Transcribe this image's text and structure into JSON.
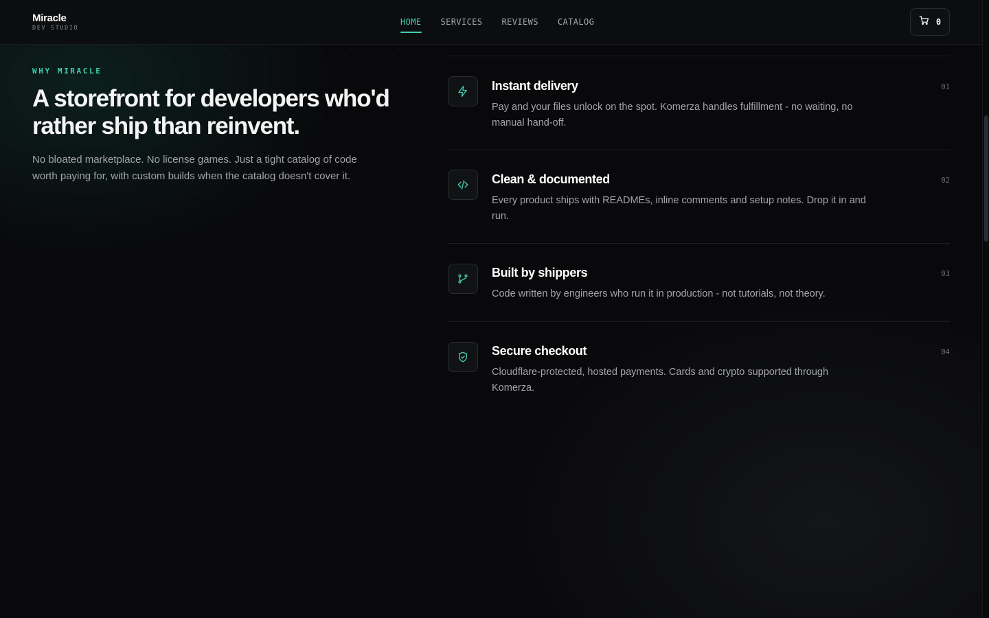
{
  "brand": {
    "name": "Miracle",
    "sub": "DEV STUDIO"
  },
  "nav": {
    "items": [
      {
        "label": "HOME",
        "active": true
      },
      {
        "label": "SERVICES",
        "active": false
      },
      {
        "label": "REVIEWS",
        "active": false
      },
      {
        "label": "CATALOG",
        "active": false
      }
    ]
  },
  "cart": {
    "count": "0",
    "icon": "cart-icon"
  },
  "section": {
    "eyebrow": "WHY MIRACLE",
    "headline": "A storefront for developers who'd rather ship than reinvent.",
    "lead": "No bloated marketplace. No license games. Just a tight catalog of code worth paying for, with custom builds when the catalog doesn't cover it."
  },
  "features": [
    {
      "icon": "lightning-icon",
      "title": "Instant delivery",
      "desc": "Pay and your files unlock on the spot. Komerza handles fulfillment - no waiting, no manual hand-off.",
      "num": "01"
    },
    {
      "icon": "code-icon",
      "title": "Clean & documented",
      "desc": "Every product ships with READMEs, inline comments and setup notes. Drop it in and run.",
      "num": "02"
    },
    {
      "icon": "git-branch-icon",
      "title": "Built by shippers",
      "desc": "Code written by engineers who run it in production - not tutorials, not theory.",
      "num": "03"
    },
    {
      "icon": "shield-check-icon",
      "title": "Secure checkout",
      "desc": "Cloudflare-protected, hosted payments. Cards and crypto supported through Komerza.",
      "num": "04"
    }
  ],
  "colors": {
    "accent": "#3fd1b3",
    "background": "#09090b",
    "text": "#f4f4f5",
    "muted": "#a3a5ab"
  }
}
